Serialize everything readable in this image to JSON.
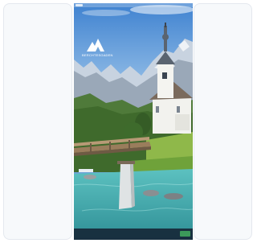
{
  "brand": {
    "logo_text": "BERCHTESGADEN",
    "logo_icon": "mountain-logo-icon"
  },
  "consent": {
    "text": "",
    "link_1": "",
    "link_2": "",
    "accept_label": ""
  },
  "colors": {
    "sky": "#4d8fd6",
    "river": "#4fb7b4",
    "meadow": "#6c9a3a",
    "church_wall": "#f2f2ee",
    "consent_bar": "#142030",
    "accept_button": "#3c9a5a"
  }
}
